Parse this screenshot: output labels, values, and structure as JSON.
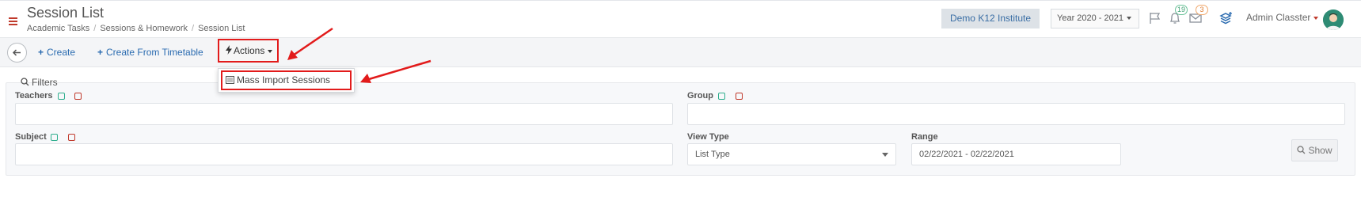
{
  "header": {
    "title": "Session List",
    "breadcrumb": [
      "Academic Tasks",
      "Sessions & Homework",
      "Session List"
    ],
    "institute": "Demo K12 Institute",
    "year": "Year 2020 - 2021",
    "notifications_count": "19",
    "messages_count": "3",
    "user_name": "Admin Classter"
  },
  "toolbar": {
    "create_label": "Create",
    "create_from_timetable_label": "Create From Timetable",
    "actions_label": "Actions",
    "actions_menu": [
      {
        "label": "Mass Import Sessions"
      }
    ]
  },
  "filters": {
    "title": "Filters",
    "teachers_label": "Teachers",
    "group_label": "Group",
    "subject_label": "Subject",
    "view_type_label": "View Type",
    "view_type_value": "List Type",
    "range_label": "Range",
    "range_value": "02/22/2021 - 02/22/2021",
    "show_label": "Show"
  },
  "colors": {
    "accent_link": "#2a6bb0",
    "highlight_red": "#e21b1b",
    "check_green": "#2fae8e"
  }
}
